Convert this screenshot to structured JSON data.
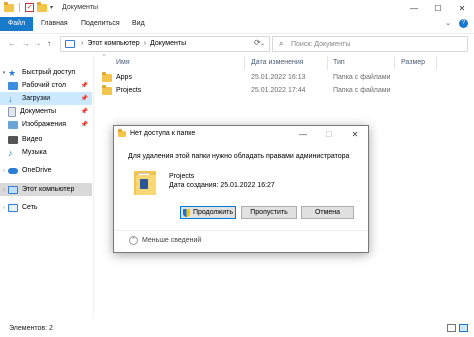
{
  "window": {
    "title": "Документы",
    "controls": {
      "minimize": "—",
      "maximize": "☐",
      "close": "✕"
    }
  },
  "ribbon": {
    "tabs": [
      "Файл",
      "Главная",
      "Поделиться",
      "Вид"
    ],
    "expand": "⌄",
    "help": "?"
  },
  "nav": {
    "back": "←",
    "forward": "→",
    "history": "⌄",
    "up": "↑"
  },
  "address": {
    "path": [
      "Этот компьютер",
      "Документы"
    ],
    "sep": "›",
    "dropdown": "⌄",
    "refresh": "⟳"
  },
  "search": {
    "placeholder": "Поиск: Документы",
    "icon": "⌕"
  },
  "sidebar": {
    "items": [
      {
        "label": "Быстрый доступ",
        "icon": "star-icon",
        "pinned": false
      },
      {
        "label": "Рабочий стол",
        "icon": "desktop-icon",
        "pinned": true
      },
      {
        "label": "Загрузки",
        "icon": "download-icon",
        "pinned": true
      },
      {
        "label": "Документы",
        "icon": "documents-icon",
        "pinned": true
      },
      {
        "label": "Изображения",
        "icon": "pictures-icon",
        "pinned": true
      },
      {
        "label": "Видео",
        "icon": "video-icon",
        "pinned": false
      },
      {
        "label": "Музыка",
        "icon": "music-icon",
        "pinned": false
      },
      {
        "label": "OneDrive",
        "icon": "cloud-icon",
        "pinned": false
      },
      {
        "label": "Этот компьютер",
        "icon": "computer-icon",
        "pinned": false
      },
      {
        "label": "Сеть",
        "icon": "network-icon",
        "pinned": false
      }
    ],
    "pin_glyph": "📌"
  },
  "filelist": {
    "columns": [
      "Имя",
      "Дата изменения",
      "Тип",
      "Размер"
    ],
    "sort_indicator": "^",
    "rows": [
      {
        "name": "Apps",
        "modified": "25.01.2022 16:13",
        "type": "Папка с файлами",
        "size": ""
      },
      {
        "name": "Projects",
        "modified": "25.01.2022 17:44",
        "type": "Папка с файлами",
        "size": ""
      }
    ]
  },
  "status": {
    "items_count": "Элементов: 2"
  },
  "dialog": {
    "title": "Нет доступа к папке",
    "message": "Для удаления этой папки нужно обладать правами администратора",
    "file_name": "Projects",
    "created": "Дата создания: 25.01.2022 16:27",
    "continue_label": "Продолжить",
    "skip_label": "Пропустить",
    "cancel_label": "Отмена",
    "less_details": "Меньше сведений",
    "controls": {
      "minimize": "—",
      "maximize": "☐",
      "close": "✕"
    }
  },
  "colors": {
    "accent": "#1979ca",
    "selected_bg": "#cce8ff",
    "folder": "#f3c54d"
  }
}
